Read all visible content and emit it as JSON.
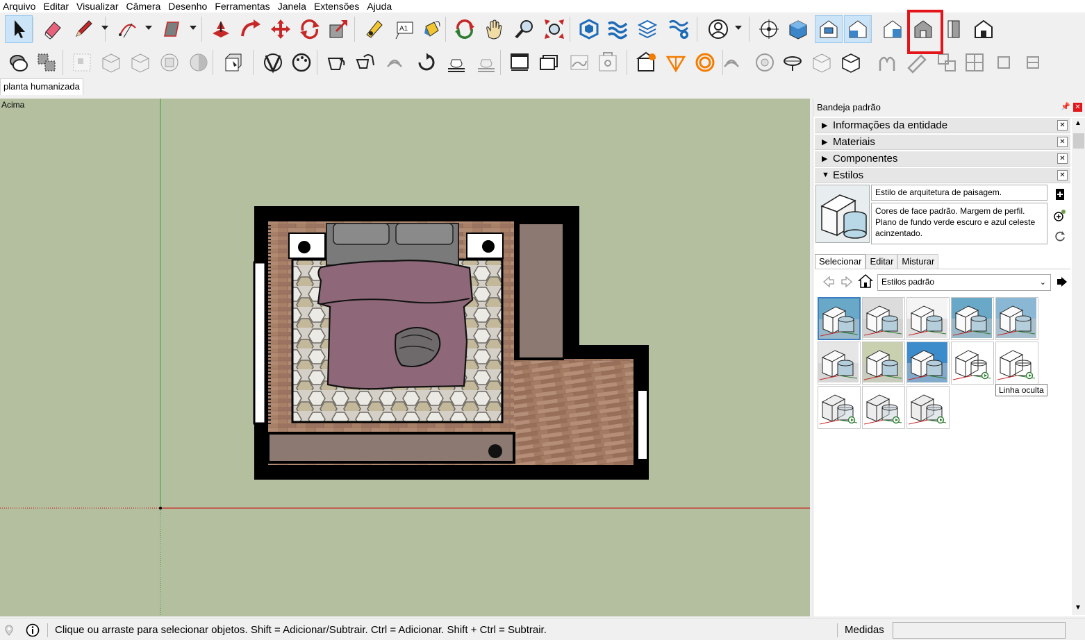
{
  "menu": [
    "Arquivo",
    "Editar",
    "Visualizar",
    "Câmera",
    "Desenho",
    "Ferramentas",
    "Janela",
    "Extensões",
    "Ajuda"
  ],
  "toolbar1_icons": [
    "select-icon",
    "eraser-icon",
    "pencil-icon",
    "arc-icon",
    "rectangle-icon",
    "push-pull-icon",
    "follow-me-icon",
    "move-icon",
    "rotate-icon",
    "scale-icon",
    "tape-measure-icon",
    "text-icon",
    "paint-bucket-icon",
    "orbit-icon",
    "pan-icon",
    "zoom-icon",
    "zoom-extents-icon",
    "warehouse-icon",
    "extension-warehouse-icon",
    "layerstack-icon",
    "extension-manager-icon",
    "account-icon",
    "position-camera-icon",
    "iso-view-icon",
    "top-view-icon",
    "front-view-icon",
    "right-view-icon",
    "back-view-icon",
    "left-view-icon",
    "bottom-view-icon"
  ],
  "toolbar2_icons": [
    "outer-shell-icon",
    "intersect-icon",
    "xray-icon",
    "back-edges-icon",
    "wireframe-icon",
    "hidden-line-icon",
    "shaded-icon",
    "shaded-textures-icon",
    "monochrome-icon",
    "section-plane-icon",
    "display-section-planes-icon",
    "sandbox-icon",
    "tools-icon",
    "materials-icon",
    "styles-icon",
    "components-icon",
    "shadows-icon",
    "fog-icon",
    "match-photo-icon",
    "edit-matched-photo-icon",
    "add-location-icon",
    "toggle-terrain-icon",
    "solid-tools-icon"
  ],
  "scene_tab": "planta humanizada",
  "view_label": "Acima",
  "tray": {
    "title": "Bandeja padrão",
    "panels": [
      {
        "label": "Informações da entidade",
        "expanded": false
      },
      {
        "label": "Materiais",
        "expanded": false
      },
      {
        "label": "Componentes",
        "expanded": false
      },
      {
        "label": "Estilos",
        "expanded": true
      }
    ],
    "style_name": "Estilo de arquitetura de paisagem.",
    "style_desc": "Cores de face padrão. Margem de perfil. Plano de fundo verde escuro e azul celeste acinzentado.",
    "tabs": [
      "Selecionar",
      "Editar",
      "Misturar"
    ],
    "active_tab": "Selecionar",
    "collection": "Estilos padrão",
    "tooltip": "Linha oculta",
    "style_thumbs": [
      {
        "bg": "#6aa8c8",
        "selected": true
      },
      {
        "bg": "#dcdcdc"
      },
      {
        "bg": "#f4f4f4"
      },
      {
        "bg": "#6aa8c8"
      },
      {
        "bg": "#8ab8d4"
      },
      {
        "bg": "#e6e6e6"
      },
      {
        "bg": "#c8d0b0"
      },
      {
        "bg": "#3c8ccc"
      },
      {
        "bg": "#ffffff",
        "wire": true
      },
      {
        "bg": "#ffffff",
        "wire": true
      },
      {
        "bg": "#ffffff",
        "xray": true
      },
      {
        "bg": "#ffffff",
        "xray": true
      },
      {
        "bg": "#ffffff",
        "xray": true
      }
    ]
  },
  "status": {
    "text": "Clique ou arraste para selecionar objetos. Shift = Adicionar/Subtrair. Ctrl = Adicionar. Shift + Ctrl = Subtrair.",
    "measure_label": "Medidas"
  },
  "colors": {
    "viewport_bg": "#b3bf9f",
    "wall": "#000000",
    "floor": "#a07860",
    "duvet": "#8e6878",
    "cabinet": "#8c7a72",
    "red_axis": "#cc0000",
    "green_axis": "#3c9c3c",
    "highlight": "#e3151b"
  }
}
